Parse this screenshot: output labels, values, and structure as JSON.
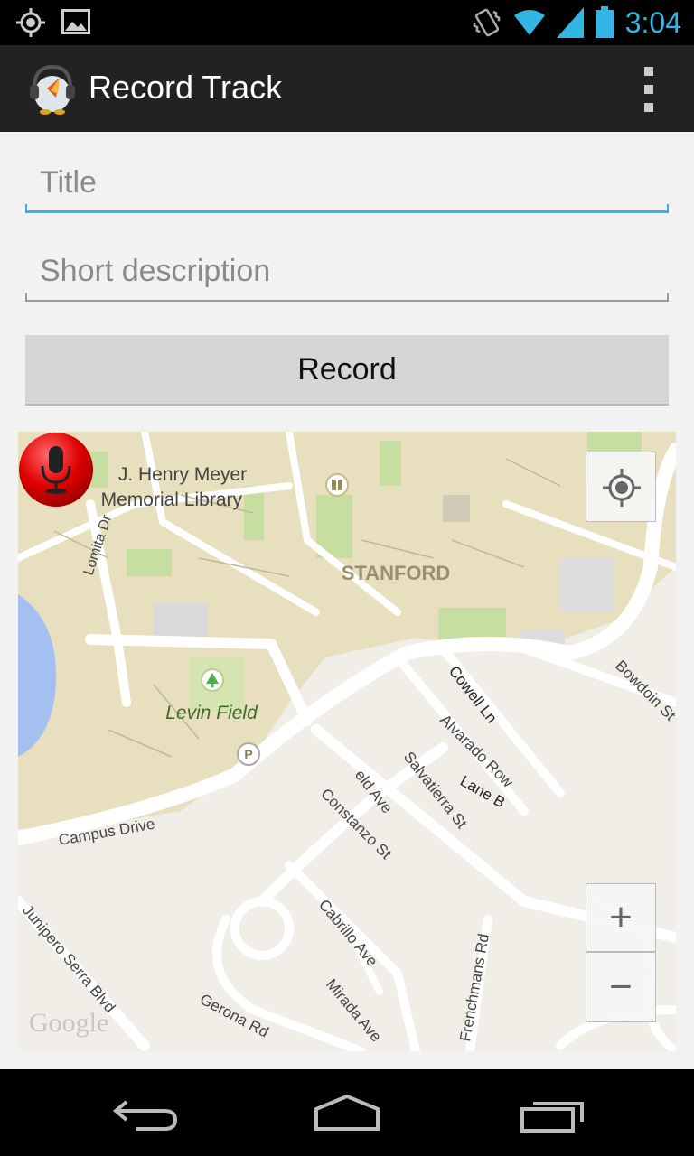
{
  "status_bar": {
    "time": "3:04",
    "icons": [
      "gps-icon",
      "image-icon",
      "vibrate-icon",
      "wifi-icon",
      "signal-icon",
      "battery-icon"
    ],
    "color": "#33b5e5"
  },
  "action_bar": {
    "title": "Record Track",
    "app_icon": "penguin-headphones-icon",
    "overflow_icon": "overflow-menu-icon"
  },
  "form": {
    "title_placeholder": "Title",
    "description_placeholder": "Short description",
    "record_label": "Record",
    "accent_color": "#33b5e5"
  },
  "map": {
    "labels": {
      "library_line1": "J. Henry Meyer",
      "library_line2": "Memorial Library",
      "stanford": "STANFORD",
      "levin_field": "Levin Field",
      "lomita": "Lomita Dr",
      "cowell": "Cowell Ln",
      "bowdoin": "Bowdoin St",
      "alvarado": "Alvarado Row",
      "lane_b": "Lane B",
      "salvatierra": "Salvatierra St",
      "field_ave": "eld Ave",
      "constanzo": "Constanzo St",
      "campus_drive": "Campus Drive",
      "cabrillo": "Cabrillo Ave",
      "frenchmans": "Frenchmans Rd",
      "junipero": "Junipero Serra Blvd",
      "gerona": "Gerona Rd",
      "mirada": "Mirada Ave",
      "google": "Google"
    },
    "controls": {
      "locate_icon": "my-location-icon",
      "zoom_in": "+",
      "zoom_out": "−"
    },
    "marker_icon": "microphone-icon"
  },
  "nav_bar": {
    "icons": [
      "back-icon",
      "home-icon",
      "recent-apps-icon"
    ]
  }
}
